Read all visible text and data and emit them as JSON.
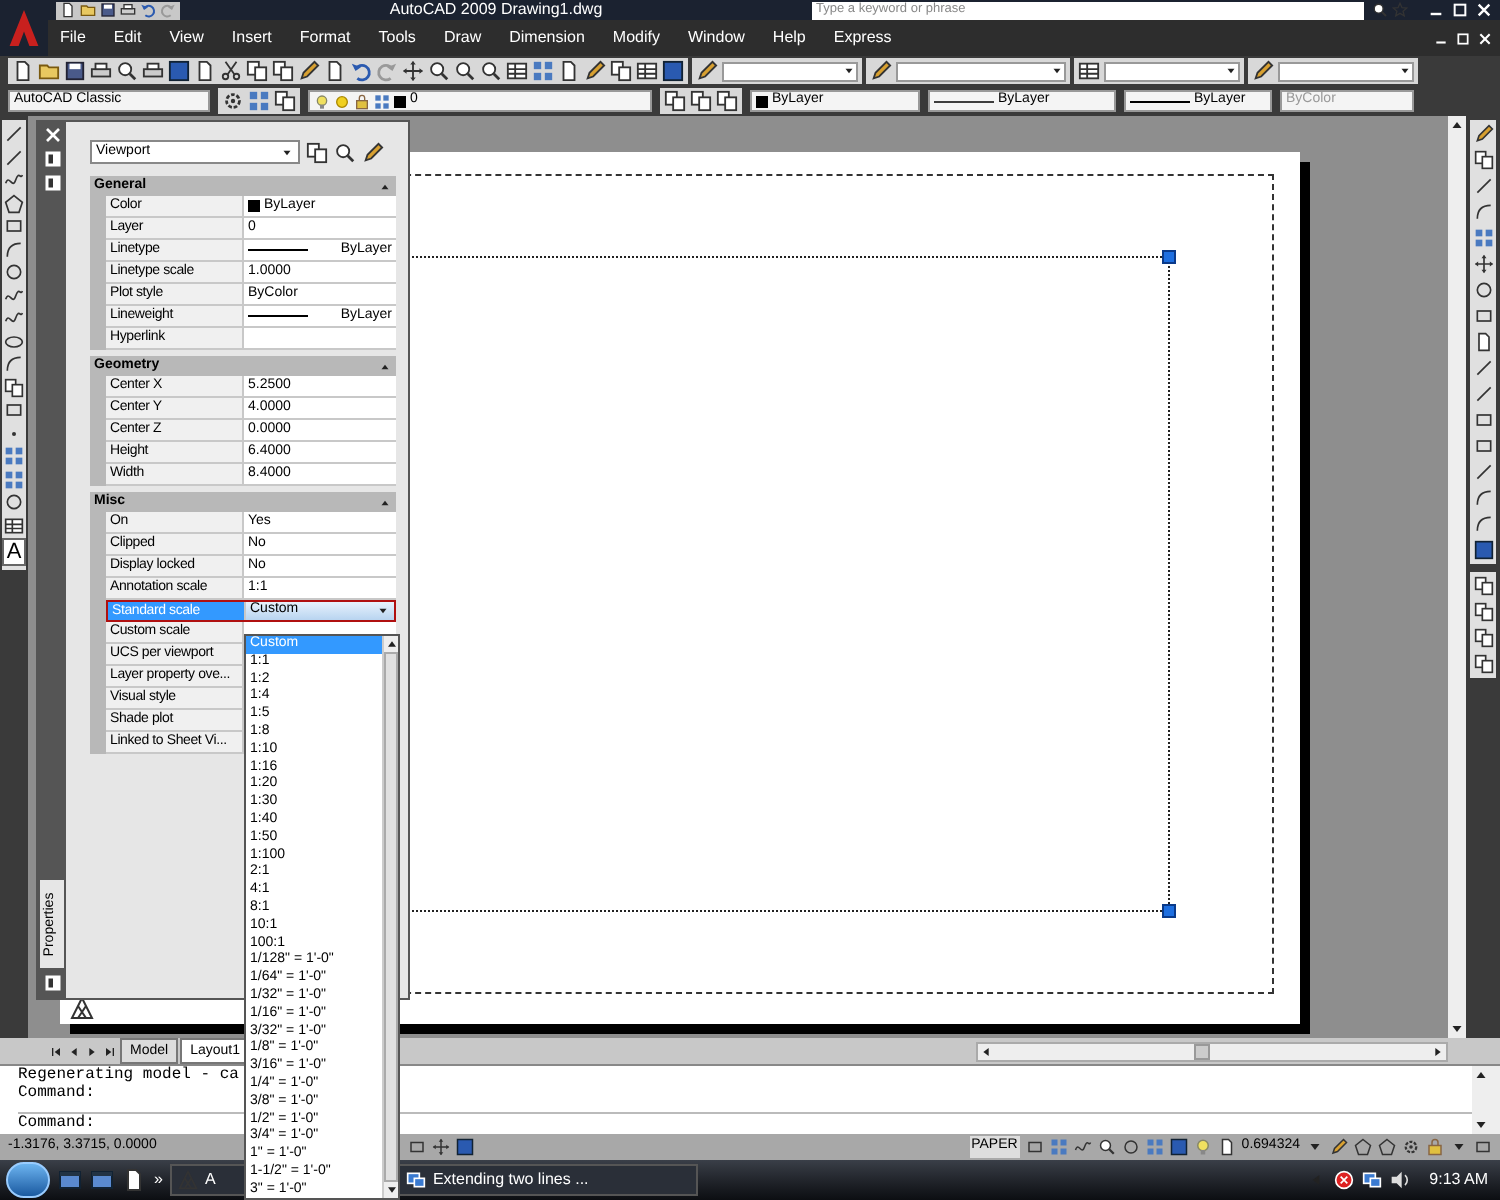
{
  "window": {
    "title": "AutoCAD 2009 Drawing1.dwg",
    "search_placeholder": "Type a keyword or phrase"
  },
  "menu": [
    "File",
    "Edit",
    "View",
    "Insert",
    "Format",
    "Tools",
    "Draw",
    "Dimension",
    "Modify",
    "Window",
    "Help",
    "Express"
  ],
  "property_bar": [
    {
      "kind": "workspace",
      "value": "AutoCAD Classic",
      "disabled": false
    },
    {
      "kind": "layer",
      "value": "0",
      "disabled": false
    },
    {
      "kind": "color",
      "value": "ByLayer",
      "disabled": false
    },
    {
      "kind": "linetype",
      "value": "ByLayer",
      "disabled": false
    },
    {
      "kind": "lineweight",
      "value": "ByLayer",
      "disabled": false
    },
    {
      "kind": "plotstyle",
      "value": "ByColor",
      "disabled": true
    }
  ],
  "left_toolbar": {
    "text_tool_glyph": "A"
  },
  "properties": {
    "object_type": "Viewport",
    "panel_label": "Properties",
    "sections": [
      {
        "title": "General",
        "expanded": true,
        "rows": [
          {
            "label": "Color",
            "value": "ByLayer",
            "kind": "color",
            "selected": false
          },
          {
            "label": "Layer",
            "value": "0",
            "kind": "text",
            "selected": false
          },
          {
            "label": "Linetype",
            "value": "ByLayer",
            "kind": "line",
            "selected": false
          },
          {
            "label": "Linetype scale",
            "value": "1.0000",
            "kind": "text",
            "selected": false
          },
          {
            "label": "Plot style",
            "value": "ByColor",
            "kind": "text",
            "selected": false
          },
          {
            "label": "Lineweight",
            "value": "ByLayer",
            "kind": "line",
            "selected": false
          },
          {
            "label": "Hyperlink",
            "kind": "text",
            "selected": false
          }
        ]
      },
      {
        "title": "Geometry",
        "expanded": true,
        "rows": [
          {
            "label": "Center X",
            "value": "5.2500",
            "kind": "text",
            "selected": false
          },
          {
            "label": "Center Y",
            "value": "4.0000",
            "kind": "text",
            "selected": false
          },
          {
            "label": "Center Z",
            "value": "0.0000",
            "kind": "text",
            "selected": false
          },
          {
            "label": "Height",
            "value": "6.4000",
            "kind": "text",
            "selected": false
          },
          {
            "label": "Width",
            "value": "8.4000",
            "kind": "text",
            "selected": false
          }
        ]
      },
      {
        "title": "Misc",
        "expanded": true,
        "rows": [
          {
            "label": "On",
            "value": "Yes",
            "kind": "text",
            "selected": false
          },
          {
            "label": "Clipped",
            "value": "No",
            "kind": "text",
            "selected": false
          },
          {
            "label": "Display locked",
            "value": "No",
            "kind": "text",
            "selected": false
          },
          {
            "label": "Annotation scale",
            "value": "1:1",
            "kind": "text",
            "selected": false
          },
          {
            "label": "Standard scale",
            "value": "Custom",
            "kind": "combo",
            "selected": true
          },
          {
            "label": "Custom scale",
            "kind": "text",
            "selected": false
          },
          {
            "label": "UCS per viewport",
            "kind": "text",
            "selected": false
          },
          {
            "label": "Layer property ove...",
            "kind": "text",
            "selected": false
          },
          {
            "label": "Visual style",
            "kind": "text",
            "selected": false
          },
          {
            "label": "Shade plot",
            "kind": "text",
            "selected": false
          },
          {
            "label": "Linked to Sheet Vi...",
            "kind": "text",
            "selected": false
          }
        ]
      }
    ]
  },
  "scale_dropdown": {
    "options": [
      {
        "label": "Custom",
        "selected": true
      },
      {
        "label": "1:1",
        "selected": false
      },
      {
        "label": "1:2",
        "selected": false
      },
      {
        "label": "1:4",
        "selected": false
      },
      {
        "label": "1:5",
        "selected": false
      },
      {
        "label": "1:8",
        "selected": false
      },
      {
        "label": "1:10",
        "selected": false
      },
      {
        "label": "1:16",
        "selected": false
      },
      {
        "label": "1:20",
        "selected": false
      },
      {
        "label": "1:30",
        "selected": false
      },
      {
        "label": "1:40",
        "selected": false
      },
      {
        "label": "1:50",
        "selected": false
      },
      {
        "label": "1:100",
        "selected": false
      },
      {
        "label": "2:1",
        "selected": false
      },
      {
        "label": "4:1",
        "selected": false
      },
      {
        "label": "8:1",
        "selected": false
      },
      {
        "label": "10:1",
        "selected": false
      },
      {
        "label": "100:1",
        "selected": false
      },
      {
        "label": "1/128\" = 1'-0\"",
        "selected": false
      },
      {
        "label": "1/64\" = 1'-0\"",
        "selected": false
      },
      {
        "label": "1/32\" = 1'-0\"",
        "selected": false
      },
      {
        "label": "1/16\" = 1'-0\"",
        "selected": false
      },
      {
        "label": "3/32\" = 1'-0\"",
        "selected": false
      },
      {
        "label": "1/8\" = 1'-0\"",
        "selected": false
      },
      {
        "label": "3/16\" = 1'-0\"",
        "selected": false
      },
      {
        "label": "1/4\" = 1'-0\"",
        "selected": false
      },
      {
        "label": "3/8\" = 1'-0\"",
        "selected": false
      },
      {
        "label": "1/2\" = 1'-0\"",
        "selected": false
      },
      {
        "label": "3/4\" = 1'-0\"",
        "selected": false
      },
      {
        "label": "1\" = 1'-0\"",
        "selected": false
      },
      {
        "label": "1-1/2\" = 1'-0\"",
        "selected": false
      },
      {
        "label": "3\" = 1'-0\"",
        "selected": false
      }
    ]
  },
  "layout_tabs": [
    {
      "label": "Model",
      "selected": false
    },
    {
      "label": "Layout1",
      "selected": true
    }
  ],
  "command_history": [
    "Regenerating model - ca",
    "Command:"
  ],
  "command_prompt": "Command:",
  "status_bar": {
    "coordinates": "-1.3176, 3.3715, 0.0000",
    "space": "PAPER",
    "viewport_scale": "0.694324"
  },
  "taskbar": {
    "more": "»",
    "tasks": [
      {
        "label": "A"
      },
      {
        "label": "Extending two lines ..."
      }
    ],
    "clock": "9:13 AM"
  }
}
